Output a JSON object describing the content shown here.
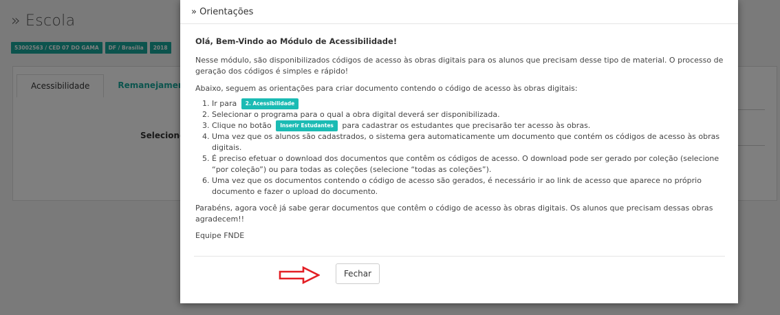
{
  "background": {
    "title": "» Escola",
    "badges": [
      "53002563 / CED 07 DO GAMA",
      "DF / Brasília",
      "2018"
    ],
    "tabs": [
      "Acessibilidade",
      "Remanejamento"
    ],
    "select_label": "Selecione"
  },
  "modal": {
    "title": "» Orientações",
    "welcome": "Olá, Bem-Vindo ao Módulo de Acessibilidade!",
    "intro": "Nesse módulo, são disponibilizados códigos de acesso às obras digitais para os alunos que precisam desse tipo de material. O processo de geração dos códigos é simples e rápido!",
    "instructions": "Abaixo, seguem as orientações para criar documento contendo o código de acesso às obras digitais:",
    "steps": {
      "s1_prefix": "Ir para",
      "s1_badge": "2. Acessibilidade",
      "s2": "Selecionar o programa para o qual a obra digital deverá ser disponibilizada.",
      "s3_prefix": "Clique no botão",
      "s3_badge": "Inserir Estudantes",
      "s3_suffix": "para cadastrar os estudantes que precisarão ter acesso às obras.",
      "s4": "Uma vez que os alunos são cadastrados, o sistema gera automaticamente um documento que contém os códigos de acesso às obras digitais.",
      "s5": "É preciso efetuar o download dos documentos que contêm os códigos de acesso. O download pode ser gerado por coleção (selecione “por coleção”) ou para todas as coleções (selecione “todas as coleções”).",
      "s6": "Uma vez que os documentos contendo o código de acesso são gerados, é necessário ir ao link de acesso que aparece no próprio documento e fazer o upload do documento."
    },
    "congrats": "Parabéns, agora você já sabe gerar documentos que contêm o código de acesso às obras digitais. Os alunos que precisam dessas obras agradecem!!",
    "signature": "Equipe FNDE",
    "close_label": "Fechar"
  },
  "colors": {
    "teal": "#1bbbb4",
    "arrow_red": "#e31e24"
  },
  "icons": {
    "arrow": "arrow-right-icon"
  }
}
